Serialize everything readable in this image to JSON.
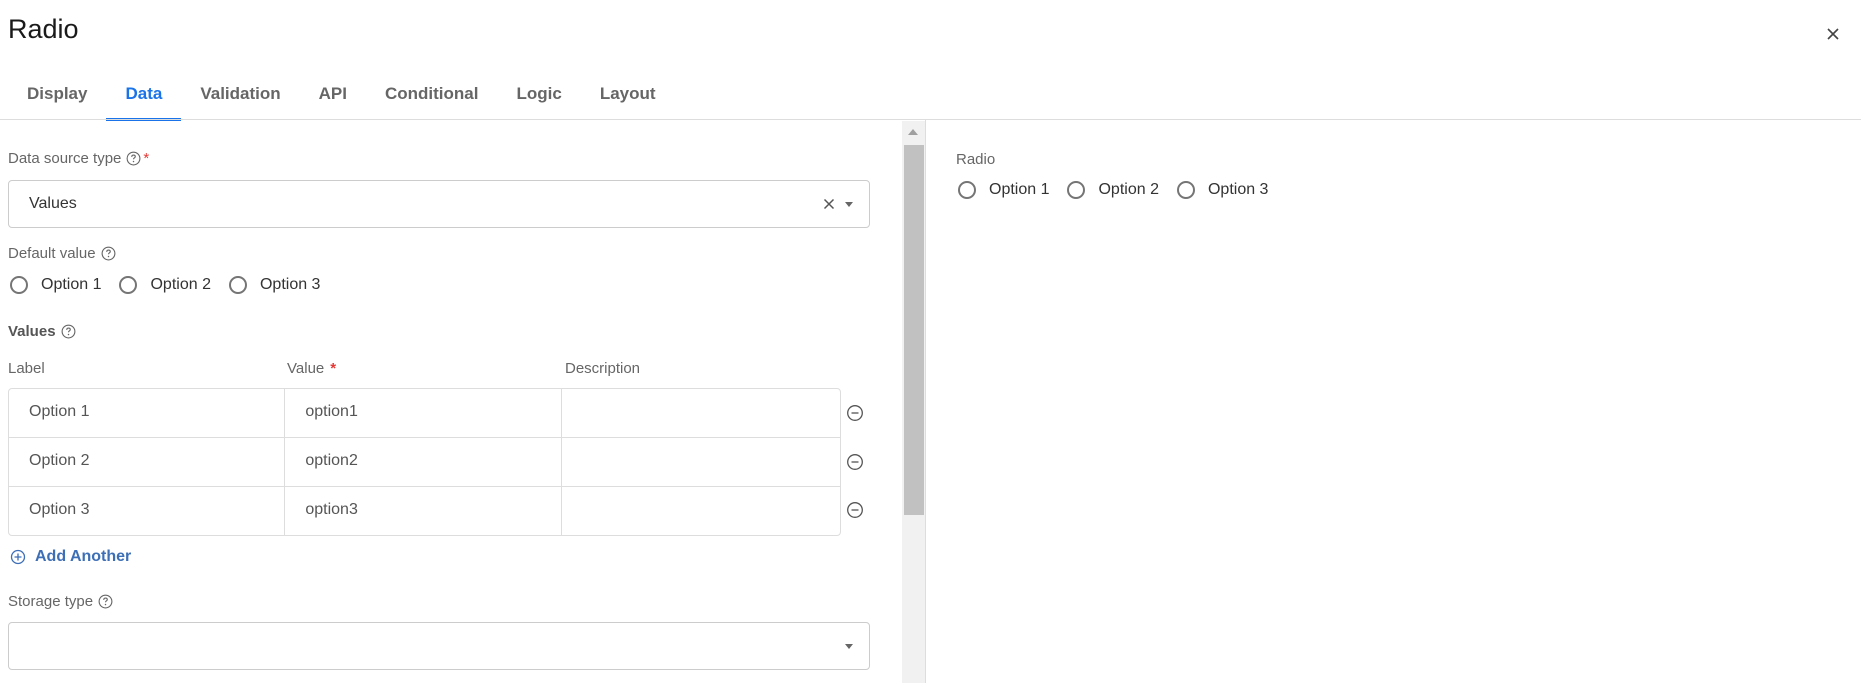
{
  "dialog": {
    "title": "Radio"
  },
  "tabs": [
    {
      "label": "Display",
      "active": false
    },
    {
      "label": "Data",
      "active": true
    },
    {
      "label": "Validation",
      "active": false
    },
    {
      "label": "API",
      "active": false
    },
    {
      "label": "Conditional",
      "active": false
    },
    {
      "label": "Logic",
      "active": false
    },
    {
      "label": "Layout",
      "active": false
    }
  ],
  "data_source": {
    "label": "Data source type",
    "required_mark": "*",
    "value": "Values"
  },
  "default_value": {
    "label": "Default value",
    "options": [
      "Option 1",
      "Option 2",
      "Option 3"
    ]
  },
  "values_grid": {
    "label": "Values",
    "columns": {
      "label": "Label",
      "value": "Value",
      "value_required_mark": "*",
      "description": "Description"
    },
    "rows": [
      {
        "label": "Option 1",
        "value": "option1",
        "description": ""
      },
      {
        "label": "Option 2",
        "value": "option2",
        "description": ""
      },
      {
        "label": "Option 3",
        "value": "option3",
        "description": ""
      }
    ],
    "add_label": "Add Another"
  },
  "storage_type": {
    "label": "Storage type",
    "value": ""
  },
  "preview": {
    "label": "Radio",
    "options": [
      "Option 1",
      "Option 2",
      "Option 3"
    ]
  },
  "colors": {
    "accent": "#1a73e8",
    "link": "#3d6fb7",
    "required": "#e53935"
  },
  "icons": {
    "close": "close-icon",
    "help": "help-circle-icon",
    "remove": "minus-circle-icon",
    "add": "plus-circle-icon"
  }
}
